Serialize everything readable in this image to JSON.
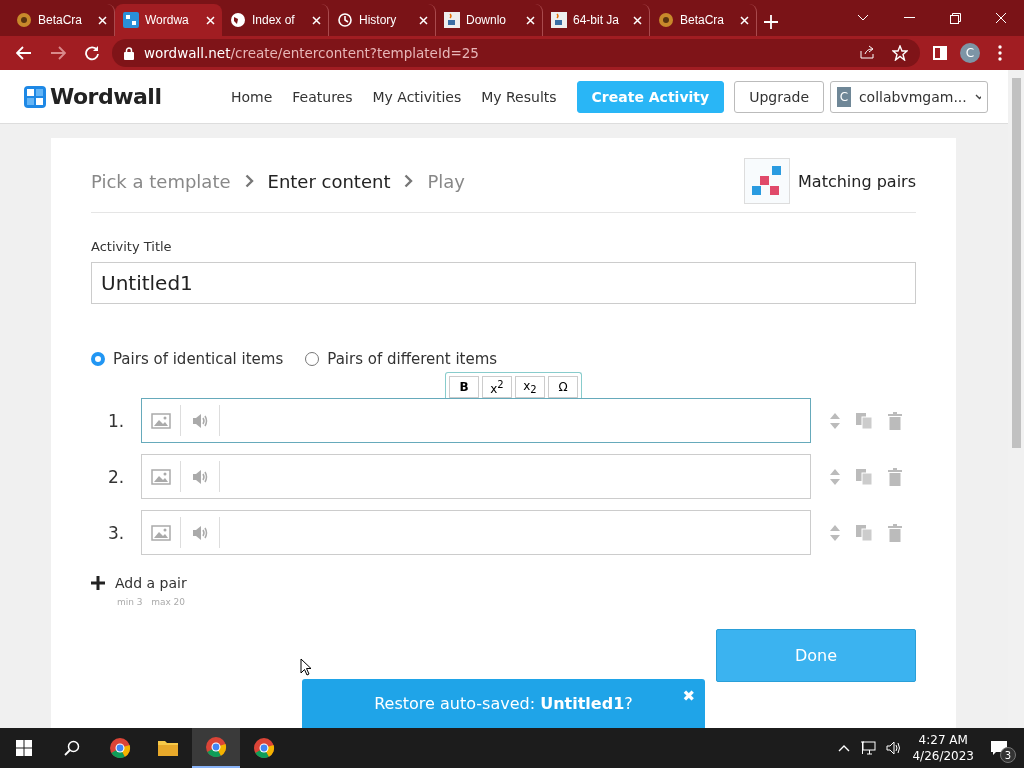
{
  "browser": {
    "tabs": [
      {
        "title": "BetaCra",
        "kind": "game",
        "selected": false
      },
      {
        "title": "Wordwa",
        "kind": "wordwall",
        "selected": true
      },
      {
        "title": "Index of",
        "kind": "globe",
        "selected": false
      },
      {
        "title": "History",
        "kind": "history",
        "selected": false
      },
      {
        "title": "Downlo",
        "kind": "java",
        "selected": false
      },
      {
        "title": "64-bit Ja",
        "kind": "java",
        "selected": false
      },
      {
        "title": "BetaCra",
        "kind": "game",
        "selected": false
      }
    ],
    "address": {
      "domain": "wordwall.net",
      "path": "/create/entercontent?templateId=25"
    },
    "profile_initial": "C"
  },
  "site": {
    "logo": "Wordwall",
    "nav": [
      "Home",
      "Features",
      "My Activities",
      "My Results"
    ],
    "create_button": "Create Activity",
    "upgrade_button": "Upgrade",
    "account": {
      "initial": "C",
      "name": "collabvmgam..."
    }
  },
  "breadcrumb": [
    {
      "label": "Pick a template",
      "selected": false
    },
    {
      "label": "Enter content",
      "selected": true
    },
    {
      "label": "Play",
      "selected": false
    }
  ],
  "template": {
    "name": "Matching pairs"
  },
  "title_field": {
    "label": "Activity Title",
    "value": "Untitled1"
  },
  "modes": [
    {
      "label": "Pairs of identical items",
      "selected": true
    },
    {
      "label": "Pairs of different items",
      "selected": false
    }
  ],
  "format_toolbar": [
    "B",
    "x$^{2}$",
    "x$_{2}$",
    "Ω"
  ],
  "pairs": [
    {
      "number": "1.",
      "focused": true
    },
    {
      "number": "2.",
      "focused": false
    },
    {
      "number": "3.",
      "focused": false
    }
  ],
  "add_pair": {
    "label": "Add a pair",
    "limits": "min 3   max 20"
  },
  "done_button": "Done",
  "toast": {
    "text": "Restore auto-saved: **Untitled1**?",
    "close": "✖"
  },
  "taskbar": {
    "apps": [
      {
        "kind": "chrome",
        "active": false
      },
      {
        "kind": "folder",
        "active": false
      },
      {
        "kind": "chrome",
        "active": true
      },
      {
        "kind": "chrome",
        "active": false
      }
    ],
    "time": "4:27 AM",
    "date": "4/26/2023",
    "notifications": "3"
  }
}
